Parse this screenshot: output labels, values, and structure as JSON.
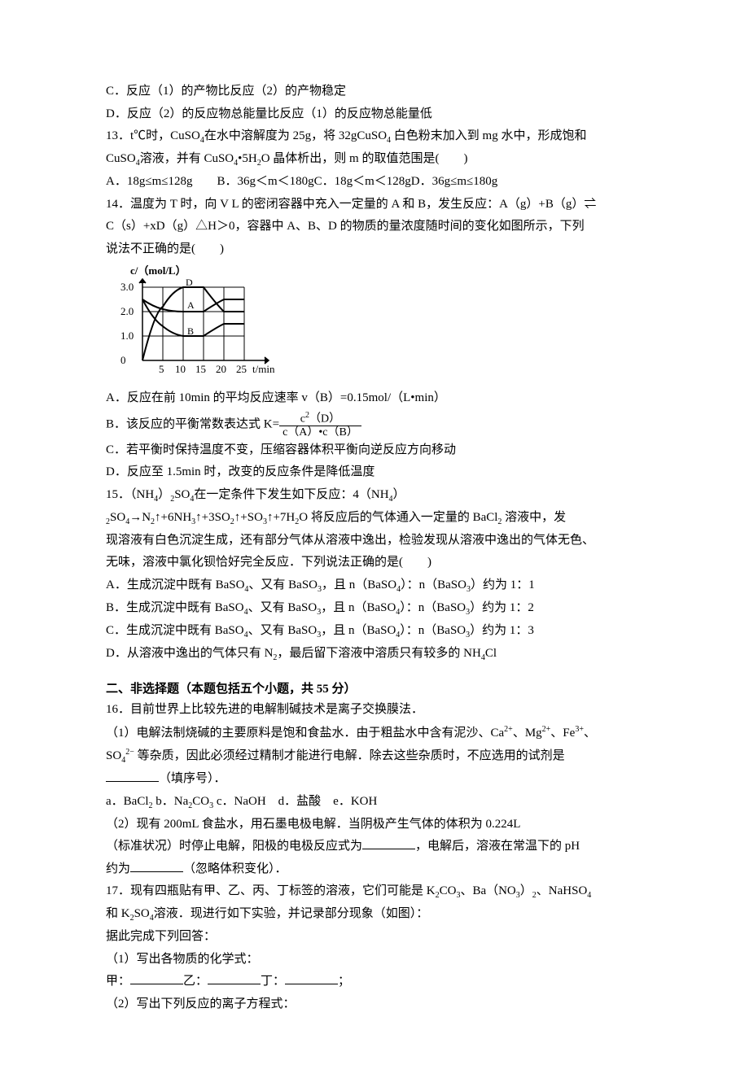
{
  "q12": {
    "opt_c": "C．反应（1）的产物比反应（2）的产物稳定",
    "opt_d": "D．反应（2）的反应物总能量比反应（1）的反应物总能量低"
  },
  "q13": {
    "stem_a": "13．t℃时，CuSO",
    "stem_b": "在水中溶解度为 25g，将 32gCuSO",
    "stem_c": " 白色粉末加入到 mg 水中，形成饱和",
    "stem_d": "CuSO",
    "stem_e": "溶液，并有 CuSO",
    "stem_f": "•5H",
    "stem_g": "O 晶体析出，则 m 的取值范围是(　　)",
    "opts": "A．18g≤m≤128g　　B．36g＜m＜180gC．18g＜m＜128gD．36g≤m≤180g"
  },
  "q14": {
    "stem_a": "14．温度为 T 时，向 V L 的密闭容器中充入一定量的 A 和 B，发生反应：A（g）+B（g）⇌",
    "stem_b": "C（s）+xD（g）△H＞0，容器中 A、B、D 的物质的量浓度随时间的变化如图所示，下列",
    "stem_c": "说法不正确的是(　　)",
    "ylabel": "c/（mol/L）",
    "xlabel": "t/min",
    "opt_a": "A．反应在前 10min 的平均反应速率 v（B）=0.15mol/（L•min）",
    "opt_b_pre": "B．该反应的平衡常数表达式 K=",
    "frac_num_a": "c",
    "frac_num_b": "（D）",
    "frac_den": "c（A）•c（B）",
    "opt_c": "C．若平衡时保持温度不变，压缩容器体积平衡向逆反应方向移动",
    "opt_d": "D．反应至 1.5min 时，改变的反应条件是降低温度"
  },
  "q15": {
    "stem_a": "15．（NH",
    "stem_b": "）",
    "stem_c": "SO",
    "stem_d": "在一定条件下发生如下反应：4（NH",
    "stem_e": "）",
    "stem_f": "SO",
    "stem_g": "→N",
    "stem_h": "↑+6NH",
    "stem_i": "↑+3SO",
    "stem_j": "↑+SO",
    "stem_k": "↑+7H",
    "stem_l": "O 将反应后的气体通入一定量的 BaCl",
    "stem_m": " 溶液中，发",
    "stem_n": "现溶液有白色沉淀生成，还有部分气体从溶液中逸出，检验发现从溶液中逸出的气体无色、",
    "stem_o": "无味，溶液中氯化钡恰好完全反应．下列说法正确的是(　　)",
    "opt_a_a": "A．生成沉淀中既有 BaSO",
    "opt_a_b": "、又有 BaSO",
    "opt_a_c": "，且 n（BaSO",
    "opt_a_d": "）：n（BaSO",
    "opt_a_e": "）约为 1：1",
    "opt_b_a": "B．生成沉淀中既有 BaSO",
    "opt_b_b": "、又有 BaSO",
    "opt_b_c": "，且 n（BaSO",
    "opt_b_d": "）：n（BaSO",
    "opt_b_e": "）约为 1：2",
    "opt_c_a": "C．生成沉淀中既有 BaSO",
    "opt_c_b": "、又有 BaSO",
    "opt_c_c": "，且 n（BaSO",
    "opt_c_d": "）：n（BaSO",
    "opt_c_e": "）约为 1：3",
    "opt_d_a": "D．从溶液中逸出的气体只有 N",
    "opt_d_b": "，最后留下溶液中溶质只有较多的 NH",
    "opt_d_c": "Cl"
  },
  "section2": "二、非选择题（本题包括五个小题，共 55 分）",
  "q16": {
    "stem_a": "16．目前世界上比较先进的电解制碱技术是离子交换膜法．",
    "p1_a": "（1）电解法制烧碱的主要原料是饱和食盐水．由于粗盐水中含有泥沙、Ca",
    "p1_b": "、Mg",
    "p1_c": "、Fe",
    "p1_d": "、",
    "p1_e": "SO",
    "p1_f": " 等杂质，因此必须经过精制才能进行电解．除去这些杂质时，不应选用的试剂是",
    "p1_g": "（填序号）．",
    "opts_a": "a．BaCl",
    "opts_b": " b．Na",
    "opts_c": "CO",
    "opts_d": " c．NaOH　d．盐酸　e．KOH",
    "p2_a": "（2）现有 200mL 食盐水，用石墨电极电解．当阴极产生气体的体积为 0.224L",
    "p2_b": "（标准状况）时停止电解，阳极的电极反应式为",
    "p2_c": "，电解后，溶液在常温下的 pH",
    "p2_d": "约为",
    "p2_e": "（忽略体积变化）．"
  },
  "q17": {
    "stem_a": "17．现有四瓶贴有甲、乙、丙、丁标签的溶液，它们可能是 K",
    "stem_b": "CO",
    "stem_c": "、Ba（NO",
    "stem_d": "）",
    "stem_e": "、NaHSO",
    "stem_f": "和 K",
    "stem_g": "SO",
    "stem_h": "溶液．现进行如下实验，并记录部分现象（如图）：",
    "p1": "据此完成下列回答：",
    "p2": "（1）写出各物质的化学式：",
    "p3_a": "甲：",
    "p3_b": "乙：",
    "p3_c": "丁：",
    "p3_d": "；",
    "p4": "（2）写出下列反应的离子方程式："
  },
  "chart_data": {
    "type": "line",
    "title": "",
    "xlabel": "t/min",
    "ylabel": "c/(mol/L)",
    "xlim": [
      0,
      30
    ],
    "ylim": [
      0,
      3.5
    ],
    "x_ticks": [
      5,
      10,
      15,
      20,
      25
    ],
    "y_ticks": [
      1.0,
      2.0,
      3.0
    ],
    "series": [
      {
        "name": "D",
        "x": [
          0,
          5,
          10,
          15,
          20,
          25
        ],
        "y": [
          0,
          2.2,
          3.0,
          3.0,
          2.0,
          2.0
        ]
      },
      {
        "name": "A",
        "x": [
          0,
          5,
          10,
          15,
          20,
          25
        ],
        "y": [
          2.5,
          2.1,
          2.0,
          2.0,
          2.5,
          2.5
        ]
      },
      {
        "name": "B",
        "x": [
          0,
          5,
          10,
          15,
          20,
          25
        ],
        "y": [
          2.5,
          1.4,
          1.0,
          1.0,
          1.5,
          1.5
        ]
      }
    ]
  }
}
